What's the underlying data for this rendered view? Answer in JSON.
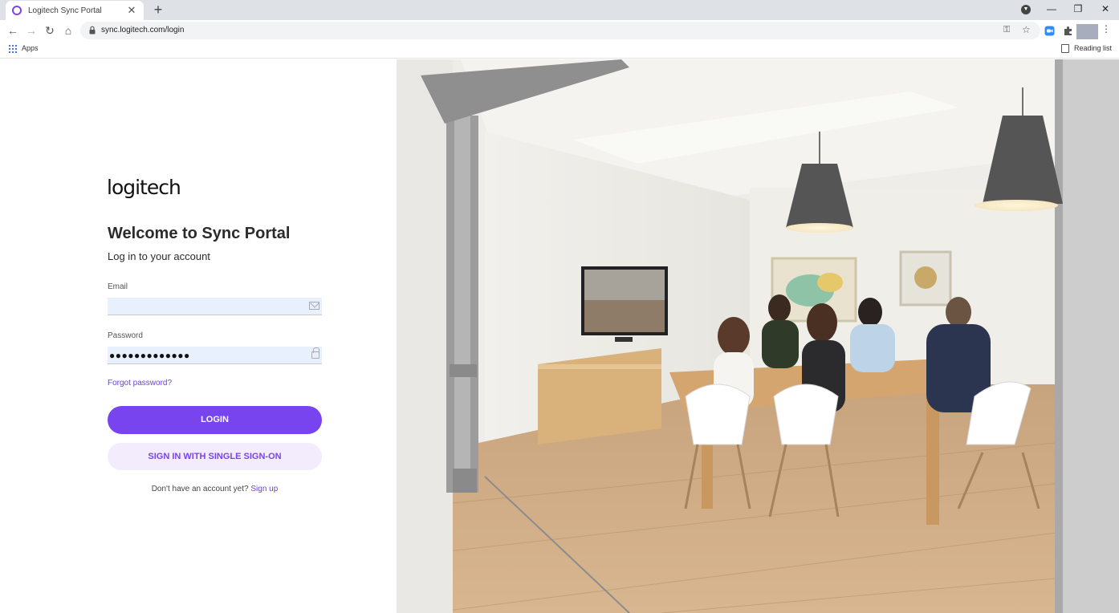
{
  "browser": {
    "tab_title": "Logitech Sync Portal",
    "url": "sync.logitech.com/login",
    "bookmarks": {
      "apps_label": "Apps",
      "reading_list_label": "Reading list"
    }
  },
  "login": {
    "logo_text": "logitech",
    "title": "Welcome to Sync Portal",
    "subtitle": "Log in to your account",
    "email_label": "Email",
    "email_value": "",
    "password_label": "Password",
    "password_value": "●●●●●●●●●●●●●",
    "forgot_link": "Forgot password?",
    "login_button": "LOGIN",
    "sso_button": "SIGN IN WITH SINGLE SIGN-ON",
    "signup_prompt": "Don't have an account yet?",
    "signup_link": "Sign up"
  },
  "colors": {
    "brand_purple": "#7844f0",
    "sso_background": "#f2ecfd",
    "autofill_background": "#e8f0fe"
  },
  "icons": {
    "email_field": "mail-icon",
    "password_field": "padlock-icon"
  }
}
